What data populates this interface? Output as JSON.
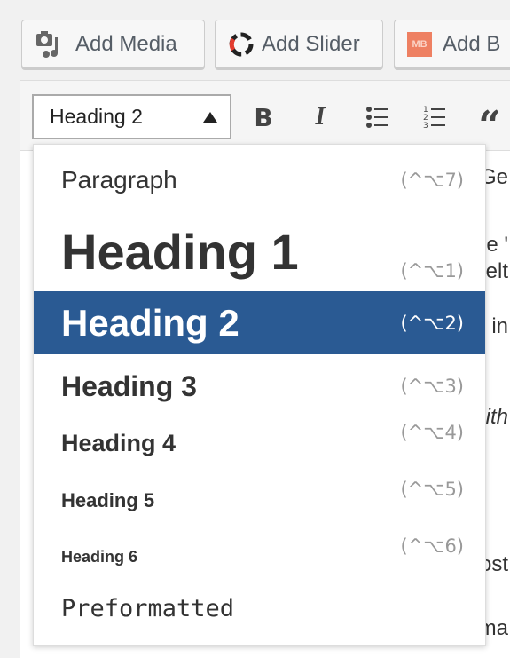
{
  "media_buttons": [
    {
      "label": "Add Media",
      "icon": "media-icon"
    },
    {
      "label": "Add Slider",
      "icon": "slider-icon"
    },
    {
      "label": "Add B",
      "icon": "mb-icon",
      "icon_text": "MB"
    }
  ],
  "format_select": {
    "value": "Heading 2"
  },
  "toolbar": {
    "bold": "B",
    "italic": "I",
    "quote": "“"
  },
  "format_menu": {
    "selected": "Heading 2",
    "accent": "#2a5a93",
    "items": [
      {
        "label": "Paragraph",
        "shortcut": "(^⌥7)"
      },
      {
        "label": "Heading 1",
        "shortcut": "(^⌥1)"
      },
      {
        "label": "Heading 2",
        "shortcut": "(^⌥2)"
      },
      {
        "label": "Heading 3",
        "shortcut": "(^⌥3)"
      },
      {
        "label": "Heading 4",
        "shortcut": "(^⌥4)"
      },
      {
        "label": "Heading 5",
        "shortcut": "(^⌥5)"
      },
      {
        "label": "Heading 6",
        "shortcut": "(^⌥6)"
      },
      {
        "label": "Preformatted",
        "shortcut": ""
      }
    ]
  },
  "editor_fragments": [
    "Ge",
    "e '",
    "elt",
    "' in",
    "ith",
    "ost",
    "ma"
  ]
}
